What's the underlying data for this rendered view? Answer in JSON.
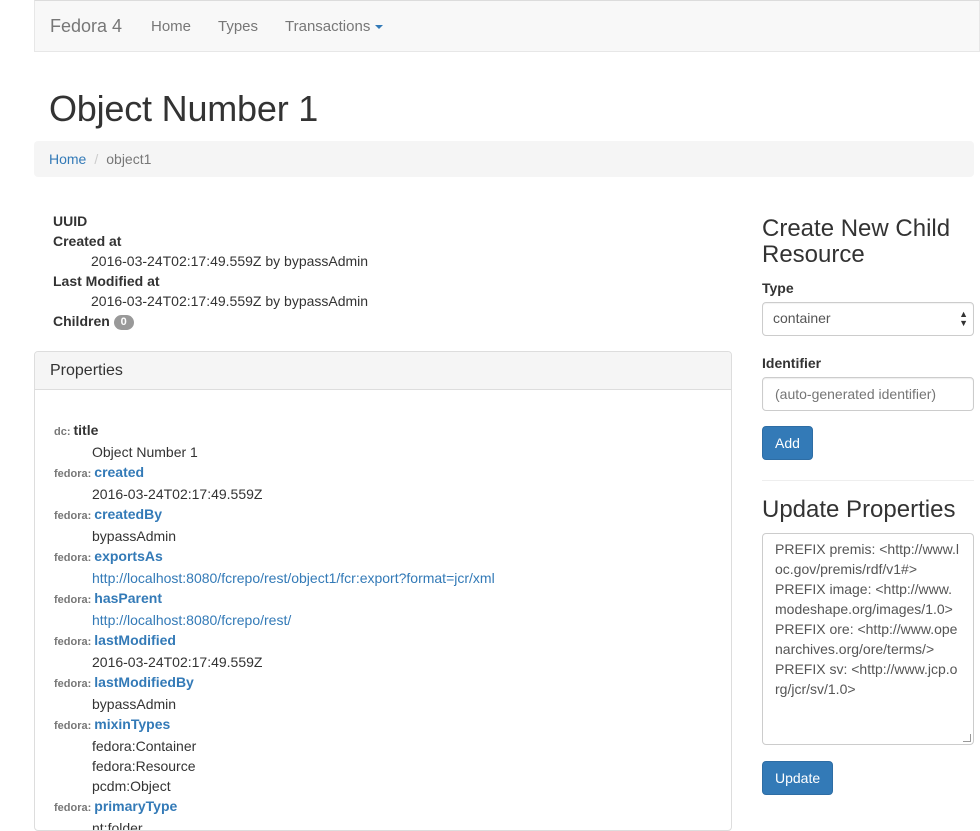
{
  "navbar": {
    "brand": "Fedora 4",
    "links": [
      "Home",
      "Types",
      "Transactions"
    ]
  },
  "page_title": "Object Number 1",
  "breadcrumb": {
    "home": "Home",
    "current": "object1"
  },
  "meta": {
    "uuid_label": "UUID",
    "created_label": "Created at",
    "created_value": "2016-03-24T02:17:49.559Z by bypassAdmin",
    "modified_label": "Last Modified at",
    "modified_value": "2016-03-24T02:17:49.559Z by bypassAdmin",
    "children_label": "Children",
    "children_count": "0"
  },
  "properties": {
    "heading": "Properties",
    "items": [
      {
        "prefix": "dc:",
        "name": "title",
        "values": [
          "Object Number 1"
        ]
      },
      {
        "prefix": "fedora:",
        "name": "created",
        "values": [
          "2016-03-24T02:17:49.559Z"
        ]
      },
      {
        "prefix": "fedora:",
        "name": "createdBy",
        "values": [
          "bypassAdmin"
        ]
      },
      {
        "prefix": "fedora:",
        "name": "exportsAs",
        "values": [
          "http://localhost:8080/fcrepo/rest/object1/fcr:export?format=jcr/xml"
        ]
      },
      {
        "prefix": "fedora:",
        "name": "hasParent",
        "values": [
          "http://localhost:8080/fcrepo/rest/"
        ]
      },
      {
        "prefix": "fedora:",
        "name": "lastModified",
        "values": [
          "2016-03-24T02:17:49.559Z"
        ]
      },
      {
        "prefix": "fedora:",
        "name": "lastModifiedBy",
        "values": [
          "bypassAdmin"
        ]
      },
      {
        "prefix": "fedora:",
        "name": "mixinTypes",
        "values": [
          "fedora:Container",
          "fedora:Resource",
          "pcdm:Object"
        ]
      },
      {
        "prefix": "fedora:",
        "name": "primaryType",
        "values": [
          "nt:folder"
        ]
      }
    ]
  },
  "create_child": {
    "heading": "Create New Child Resource",
    "type_label": "Type",
    "type_value": "container",
    "identifier_label": "Identifier",
    "identifier_placeholder": "(auto-generated identifier)",
    "add_label": "Add"
  },
  "update_properties": {
    "heading": "Update Properties",
    "text": "PREFIX premis: <http://www.loc.gov/premis/rdf/v1#>\nPREFIX image: <http://www.modeshape.org/images/1.0>\nPREFIX ore: <http://www.openarchives.org/ore/terms/>\nPREFIX sv: <http://www.jcp.org/jcr/sv/1.0>",
    "update_label": "Update"
  },
  "colors": {
    "link": "#337ab7",
    "primary_button": "#337ab7",
    "navbar_bg": "#f8f8f8"
  }
}
